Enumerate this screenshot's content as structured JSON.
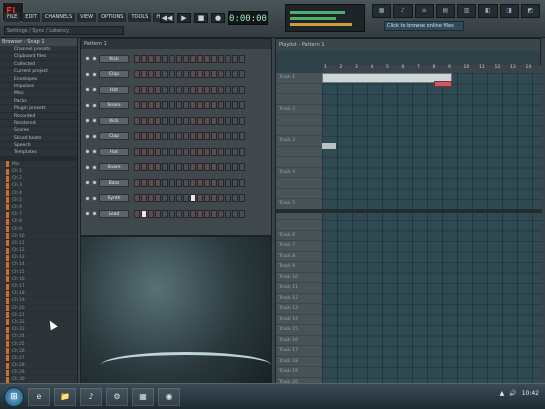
{
  "topbar": {
    "logo_text": "FL",
    "menu": [
      "FILE",
      "EDIT",
      "CHANNELS",
      "VIEW",
      "OPTIONS",
      "TOOLS",
      "HELP"
    ],
    "hint_text": "Settings / Sync / Latency",
    "tempo": "0:00:00",
    "transport": [
      "◀◀",
      "▶",
      "■",
      "●"
    ],
    "pattern_buttons": [
      "▦",
      "♪",
      "≡",
      "▤",
      "▥",
      "◧",
      "◨",
      "◩"
    ],
    "browser_hint": "Click to browse online files"
  },
  "browser": {
    "title": "Browser - Snap 1",
    "items": [
      "Channel presets",
      "Clipboard files",
      "Collected",
      "Current project",
      "Envelopes",
      "Impulses",
      "Misc",
      "Packs",
      "Plugin presets",
      "Recorded",
      "Rendered",
      "Scores",
      "Sliced beats",
      "Speech",
      "Templates"
    ],
    "channels": [
      "Mix",
      "Ch 1",
      "Ch 2",
      "Ch 3",
      "Ch 4",
      "Ch 5",
      "Ch 6",
      "Ch 7",
      "Ch 8",
      "Ch 9",
      "Ch 10",
      "Ch 11",
      "Ch 12",
      "Ch 13",
      "Ch 14",
      "Ch 15",
      "Ch 16",
      "Ch 17",
      "Ch 18",
      "Ch 19",
      "Ch 20",
      "Ch 21",
      "Ch 22",
      "Ch 23",
      "Ch 24",
      "Ch 25",
      "Ch 26",
      "Ch 27",
      "Ch 28",
      "Ch 29",
      "Ch 30",
      "Ch 31",
      "Ch 32"
    ],
    "footer": [
      "Master",
      "Send 1",
      "Send 2"
    ]
  },
  "stepseq": {
    "title": "Pattern 1",
    "channels": [
      "Kick",
      "Clap",
      "Hat",
      "Snare",
      "Kick",
      "Clap",
      "Hat",
      "Snare",
      "Bass",
      "Synth",
      "Lead"
    ]
  },
  "playlist": {
    "title": "Playlist - Pattern 1",
    "ruler": [
      "1",
      "2",
      "3",
      "4",
      "5",
      "6",
      "7",
      "8",
      "9",
      "10",
      "11",
      "12",
      "13",
      "14"
    ],
    "tracks": [
      "Track 1",
      "",
      "",
      "Track 2",
      "",
      "",
      "Track 3",
      "",
      "",
      "Track 4",
      "",
      "",
      "Track 5",
      "",
      "",
      "Track 6",
      "Track 7",
      "Track 8",
      "Track 9",
      "Track 10",
      "Track 11",
      "Track 12",
      "Track 13",
      "Track 14",
      "Track 15",
      "Track 16",
      "Track 17",
      "Track 18",
      "Track 19",
      "Track 20"
    ]
  },
  "taskbar": {
    "start": "⊞",
    "tasks": [
      "e",
      "📁",
      "♪",
      "⚙",
      "▦",
      "◉"
    ],
    "tray": [
      "▲",
      "🔊",
      "10:42"
    ]
  }
}
